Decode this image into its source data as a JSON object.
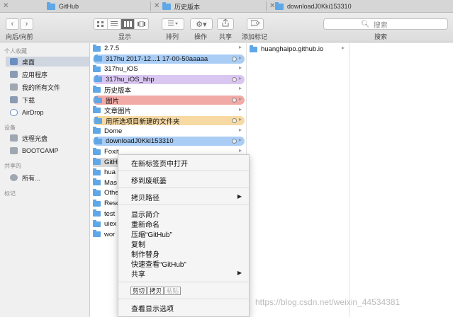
{
  "tabs": [
    {
      "label": "GitHub"
    },
    {
      "label": "历史版本"
    },
    {
      "label": "downloadJ0Kki153310"
    }
  ],
  "toolbar": {
    "nav_label": "向后/向前",
    "display_label": "显示",
    "arrange_label": "排列",
    "action_label": "操作",
    "share_label": "共享",
    "tag_label": "添加标记",
    "search_placeholder": "搜索",
    "search_label": "搜索"
  },
  "sidebar": {
    "favorites_header": "个人收藏",
    "favorites": [
      {
        "label": "桌面",
        "icon": "desktop-icon"
      },
      {
        "label": "应用程序",
        "icon": "applications-icon"
      },
      {
        "label": "我的所有文件",
        "icon": "all-files-icon"
      },
      {
        "label": "下载",
        "icon": "downloads-icon"
      },
      {
        "label": "AirDrop",
        "icon": "airdrop-icon"
      }
    ],
    "devices_header": "设备",
    "devices": [
      {
        "label": "远程光盘",
        "icon": "remote-disc-icon"
      },
      {
        "label": "BOOTCAMP",
        "icon": "drive-icon"
      }
    ],
    "shared_header": "共享的",
    "shared": [
      {
        "label": "所有...",
        "icon": "network-icon"
      }
    ],
    "tags_header": "标记"
  },
  "column1": {
    "items": [
      {
        "label": "2.7.5",
        "tag": ""
      },
      {
        "label": "317hu 2017-12...1 17-00-50aaaaa",
        "tag": "#a9cdf5"
      },
      {
        "label": "317hu_iOS",
        "tag": ""
      },
      {
        "label": "317hu_iOS_hhp",
        "tag": "#d9c6f1"
      },
      {
        "label": "历史版本",
        "tag": ""
      },
      {
        "label": "图片",
        "tag": "#f2aaa7"
      },
      {
        "label": "文章图片",
        "tag": ""
      },
      {
        "label": "用所选项目新建的文件夹",
        "tag": "#f6d9a3"
      },
      {
        "label": "Dome",
        "tag": ""
      },
      {
        "label": "downloadJ0Kki153310",
        "tag": "#a9cdf5"
      },
      {
        "label": "Foxit",
        "tag": ""
      },
      {
        "label": "GitHub",
        "tag": ""
      },
      {
        "label": "hua",
        "tag": ""
      },
      {
        "label": "Mas",
        "tag": ""
      },
      {
        "label": "Othe",
        "tag": ""
      },
      {
        "label": "Reso",
        "tag": ""
      },
      {
        "label": "test",
        "tag": ""
      },
      {
        "label": "uiex",
        "tag": ""
      },
      {
        "label": "wor",
        "tag": ""
      }
    ]
  },
  "column2": {
    "items": [
      {
        "label": "huanghaipo.github.io"
      }
    ]
  },
  "context_menu": {
    "open_new_tab": "在新标签页中打开",
    "move_trash": "移到废纸篓",
    "copy_path": "拷贝路径",
    "get_info": "显示简介",
    "rename": "重新命名",
    "compress": "压缩“GitHub”",
    "duplicate": "复制",
    "make_alias": "制作替身",
    "quick_look": "快速查看“GitHub”",
    "share": "共享",
    "cut_btn": "剪切",
    "copy_btn": "拷贝",
    "paste_btn": "粘贴",
    "view_options": "查看显示选项"
  },
  "watermark": "https://blog.csdn.net/weixin_44534381"
}
